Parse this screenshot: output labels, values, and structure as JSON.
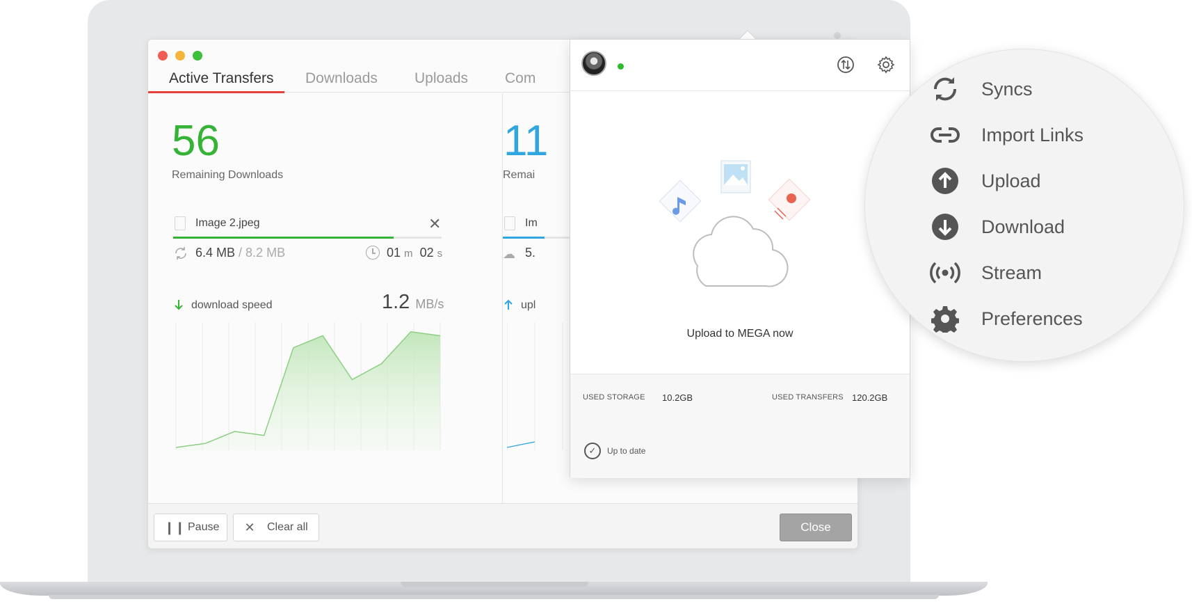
{
  "window": {
    "traffic_lights": [
      "#f25c54",
      "#f5b53b",
      "#3cc03c"
    ]
  },
  "tabs": [
    {
      "label": "Active Transfers",
      "active": true
    },
    {
      "label": "Downloads",
      "active": false
    },
    {
      "label": "Uploads",
      "active": false
    },
    {
      "label": "Com",
      "active": false
    }
  ],
  "downloads_panel": {
    "count": "56",
    "count_label": "Remaining Downloads",
    "file_name": "Image 2.jpeg",
    "progress": 0.82,
    "transferred": "6.4 MB",
    "total": "/ 8.2 MB",
    "time_min": "01",
    "time_min_unit": "m",
    "time_sec": "02",
    "time_sec_unit": "s",
    "speed_label": "download speed",
    "speed_value": "1.2",
    "speed_unit": "MB/s",
    "accent": "#36b336"
  },
  "uploads_panel": {
    "count": "11",
    "count_label": "Remai",
    "file_name": "Im",
    "size": "5.",
    "speed_label": "upl",
    "accent": "#2fa6e0"
  },
  "chart_data": {
    "type": "area",
    "series": [
      {
        "values": [
          0,
          1,
          4,
          3,
          25,
          28,
          17,
          21,
          29,
          28
        ]
      }
    ],
    "ylim": [
      0,
      30
    ],
    "grid": true
  },
  "footer": {
    "pause_label": "Pause",
    "clear_label": "Clear all",
    "close_label": "Close"
  },
  "popup": {
    "upload_cta": "Upload to MEGA now",
    "used_storage_label": "USED STORAGE",
    "used_storage_value": "10.2GB",
    "used_transfers_label": "USED TRANSFERS",
    "used_transfers_value": "120.2GB",
    "status_text": "Up to date",
    "online_color": "#2cbb2c"
  },
  "menu": {
    "items": [
      {
        "label": "Syncs",
        "icon": "sync-icon"
      },
      {
        "label": "Import Links",
        "icon": "link-icon"
      },
      {
        "label": "Upload",
        "icon": "upload-icon"
      },
      {
        "label": "Download",
        "icon": "download-icon"
      },
      {
        "label": "Stream",
        "icon": "stream-icon"
      },
      {
        "label": "Preferences",
        "icon": "gear-icon"
      }
    ]
  }
}
